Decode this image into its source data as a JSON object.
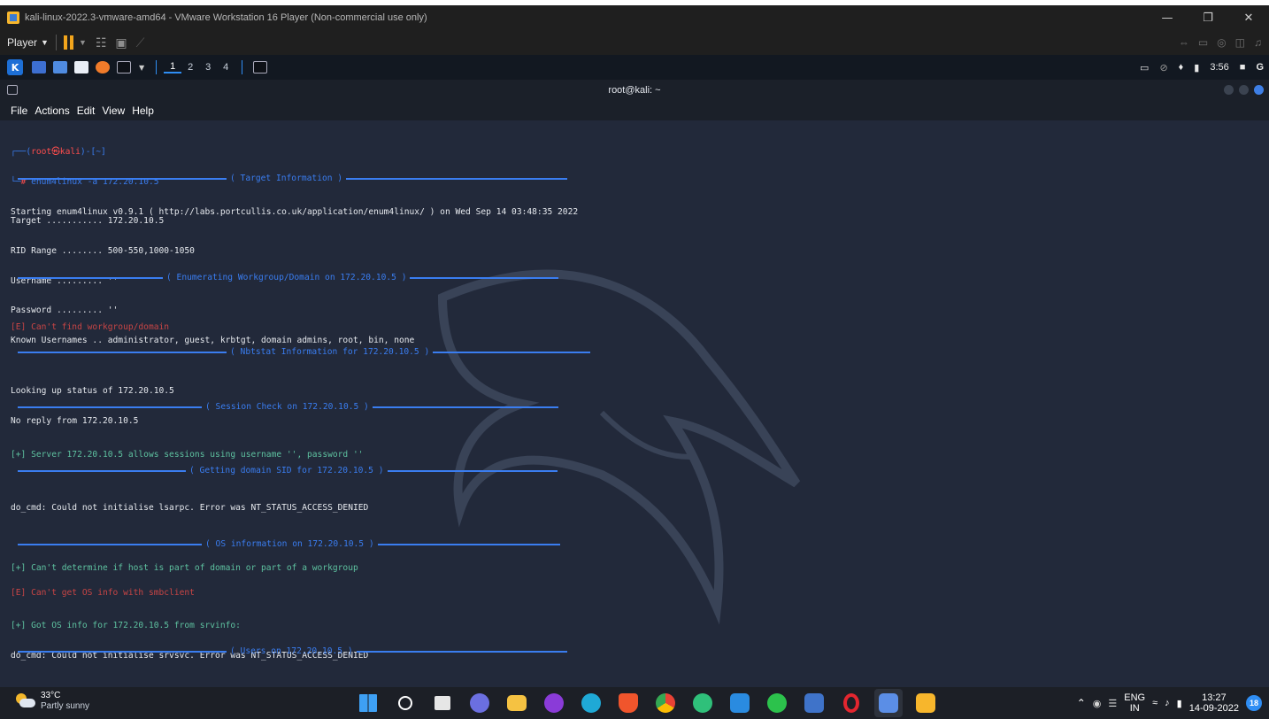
{
  "vmware": {
    "title": "kali-linux-2022.3-vmware-amd64 - VMware Workstation 16 Player (Non-commercial use only)",
    "player_menu": "Player",
    "window_controls": [
      "—",
      "❐",
      "✕"
    ]
  },
  "kali_panel": {
    "workspaces": [
      "1",
      "2",
      "3",
      "4"
    ],
    "active_workspace": "1",
    "time": "3:56"
  },
  "terminal": {
    "title": "root@kali: ~",
    "menu": [
      "File",
      "Actions",
      "Edit",
      "View",
      "Help"
    ],
    "prompt_top": "┌──(",
    "prompt_user": "root㉿kali",
    "prompt_dir": ")-[~]",
    "prompt_bottom": "└─",
    "prompt_hash": "#",
    "command": " enum4linux -a 172.20.10.5",
    "lines": {
      "starting": "Starting enum4linux v0.9.1 ( http://labs.portcullis.co.uk/application/enum4linux/ ) on Wed Sep 14 03:48:35 2022",
      "banner_target": "( Target Information )",
      "target": "Target ........... 172.20.10.5",
      "rid_range": "RID Range ........ 500-550,1000-1050",
      "username": "Username ......... ''",
      "password": "Password ......... ''",
      "known_users": "Known Usernames .. administrator, guest, krbtgt, domain admins, root, bin, none",
      "banner_workgroup": "( Enumerating Workgroup/Domain on 172.20.10.5 )",
      "err_workgroup": "[E] Can't find workgroup/domain",
      "banner_nbtstat": "( Nbtstat Information for 172.20.10.5 )",
      "looking_up": "Looking up status of 172.20.10.5",
      "no_reply": "No reply from 172.20.10.5",
      "banner_session": "( Session Check on 172.20.10.5 )",
      "session_ok": "[+] Server 172.20.10.5 allows sessions using username '', password ''",
      "banner_sid": "( Getting domain SID for 172.20.10.5 )",
      "lsarpc_err": "do_cmd: Could not initialise lsarpc. Error was NT_STATUS_ACCESS_DENIED",
      "cant_determine": "[+] Can't determine if host is part of domain or part of a workgroup",
      "banner_os": "( OS information on 172.20.10.5 )",
      "err_os": "[E] Can't get OS info with smbclient",
      "got_os": "[+] Got OS info for 172.20.10.5 from srvinfo:",
      "srvsvc_err": "do_cmd: Could not initialise srvsvc. Error was NT_STATUS_ACCESS_DENIED",
      "banner_users": "( Users on 172.20.10.5 )"
    }
  },
  "taskbar": {
    "weather_temp": "33°C",
    "weather_cond": "Partly sunny",
    "lang_top": "ENG",
    "lang_bottom": "IN",
    "clock_time": "13:27",
    "clock_date": "14-09-2022",
    "notifications": "18"
  },
  "colors": {
    "prompt_blue": "#3a7df0",
    "prompt_red": "#ff4d4d",
    "success_green": "#5ec2a0",
    "error_red": "#c84545"
  }
}
